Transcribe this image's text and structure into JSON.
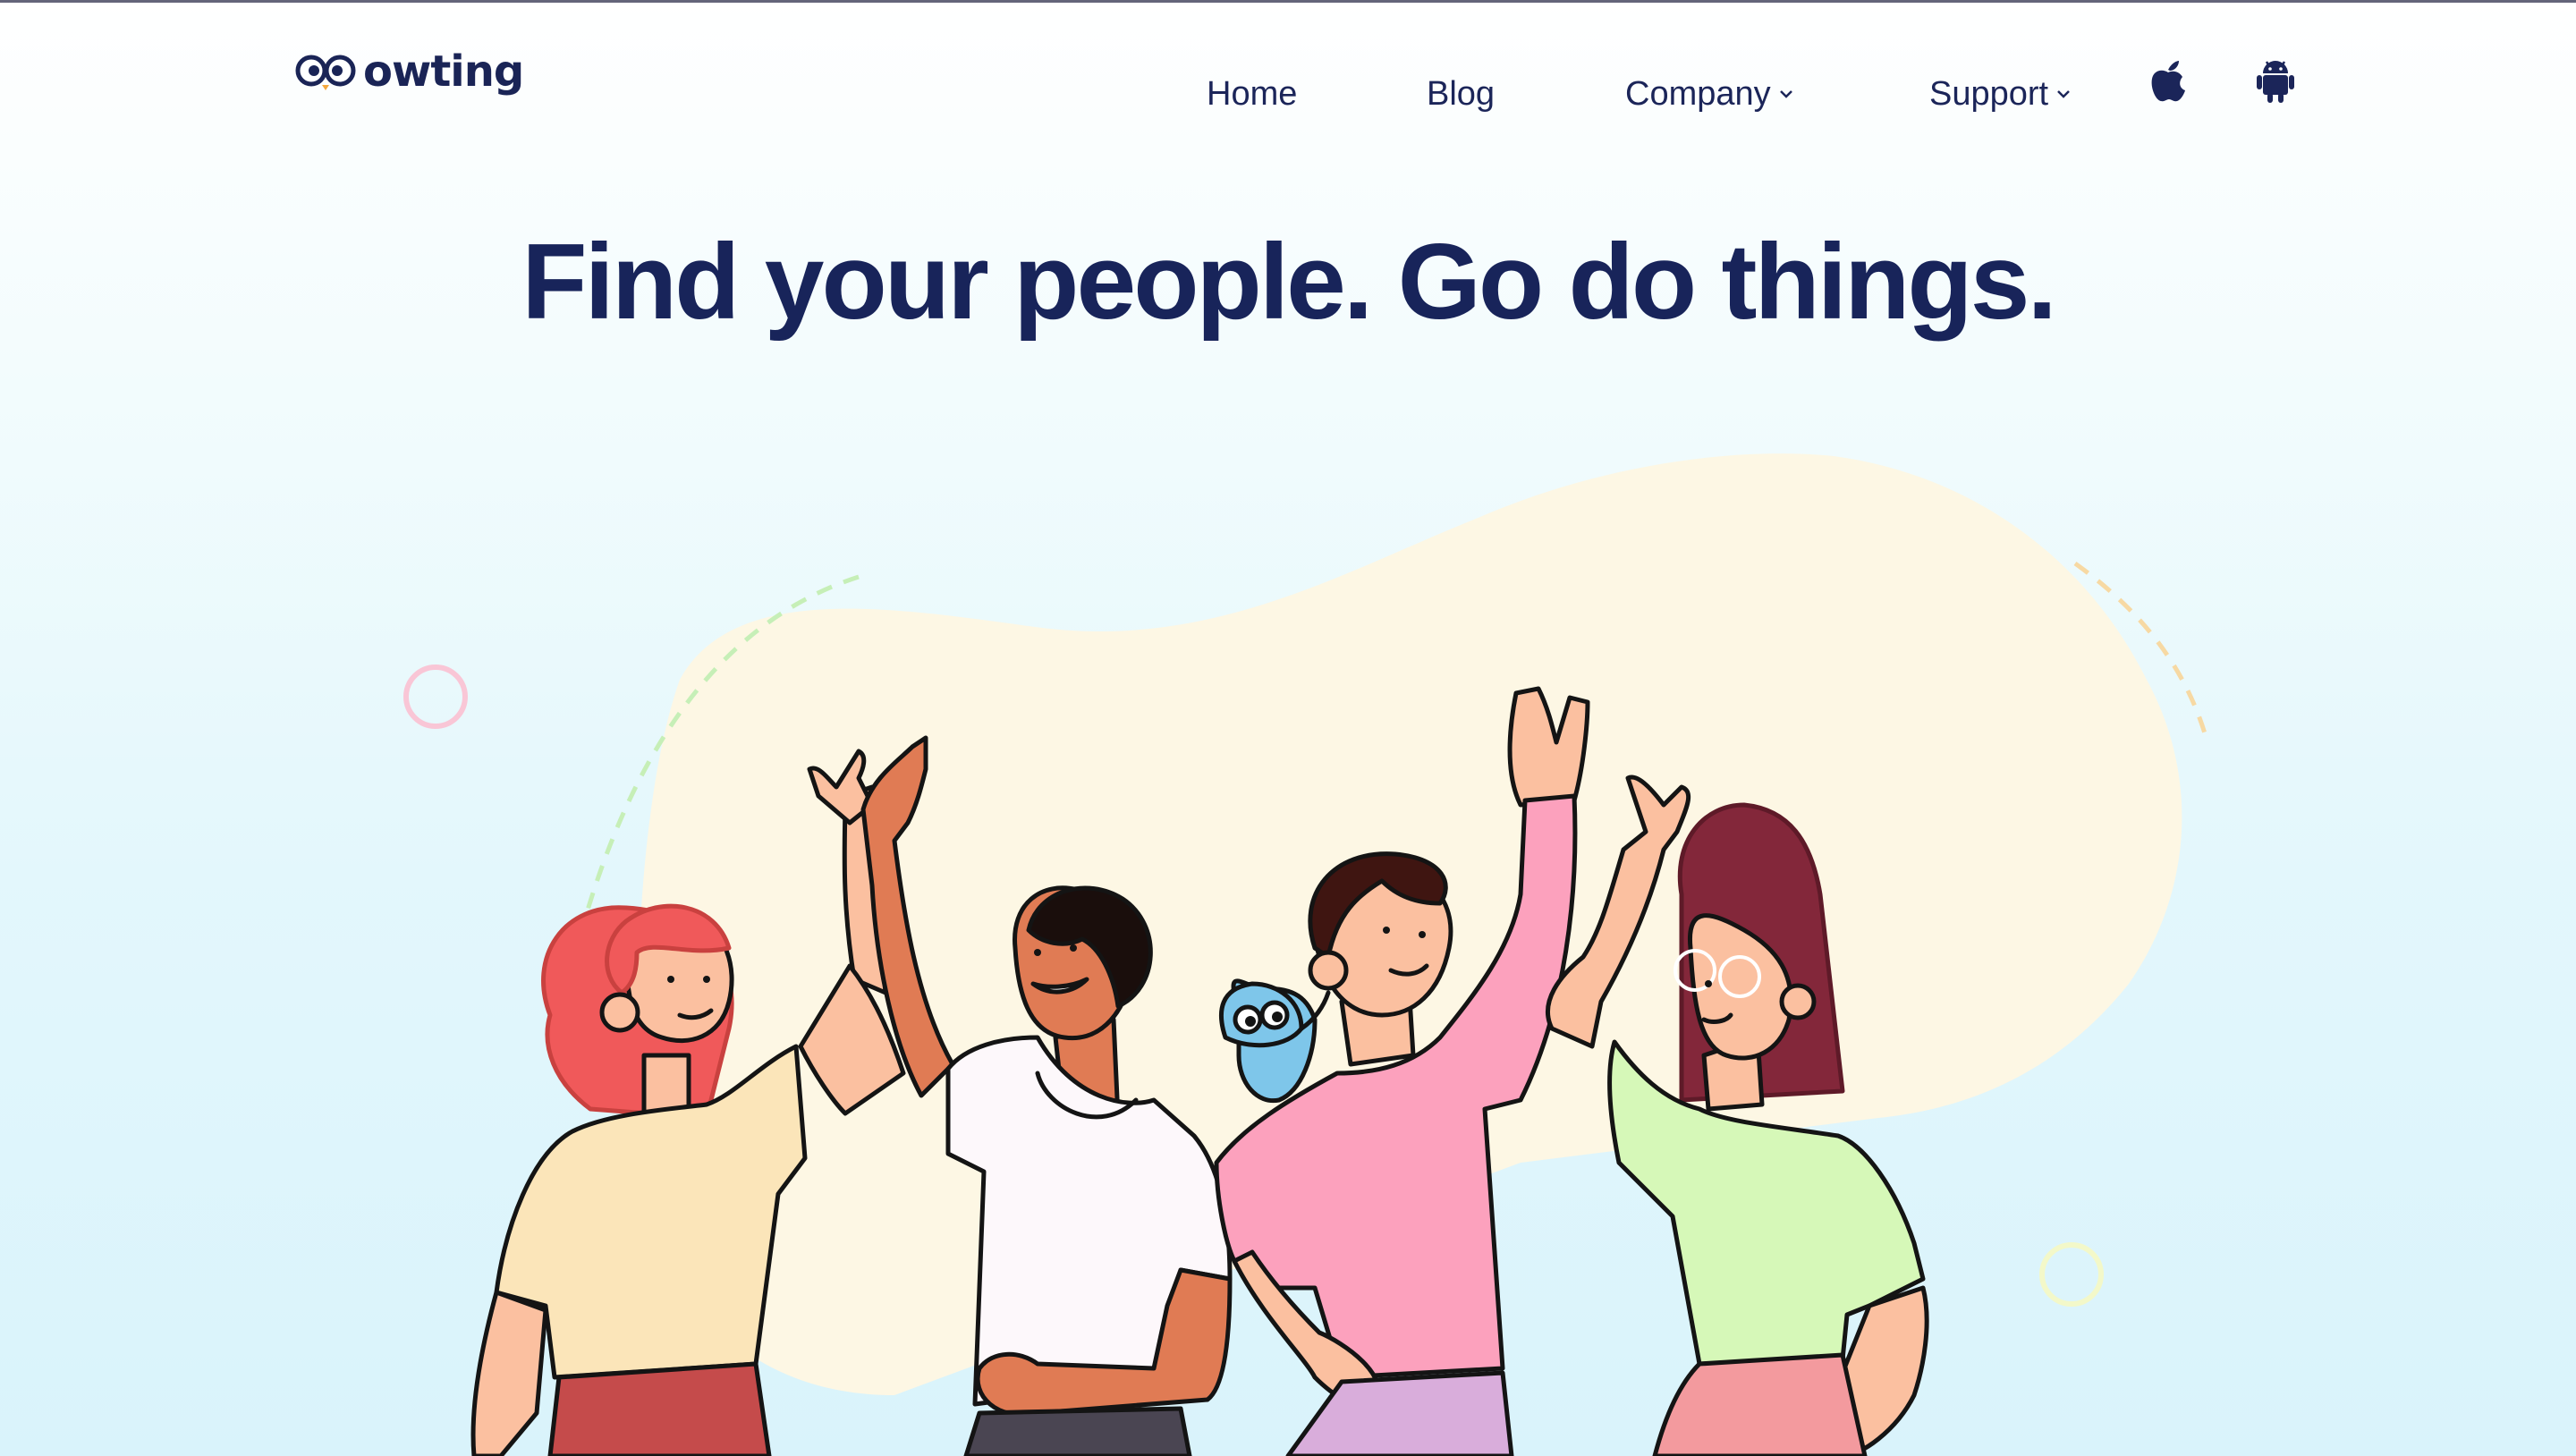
{
  "brand": {
    "name": "owting",
    "icon": "owl-eyes-icon",
    "color": "#1a2456"
  },
  "nav": {
    "items": [
      {
        "label": "Home",
        "has_dropdown": false
      },
      {
        "label": "Blog",
        "has_dropdown": false
      },
      {
        "label": "Company",
        "has_dropdown": true
      },
      {
        "label": "Support",
        "has_dropdown": true
      }
    ],
    "app_store_icons": [
      "apple-icon",
      "android-icon"
    ]
  },
  "hero": {
    "title": "Find your people. Go do things."
  },
  "colors": {
    "text": "#18245a",
    "blob": "#fdf7e4",
    "shirt_yellow": "#fbe5b9",
    "shirt_white": "#fdf8fb",
    "shirt_pink": "#fca1bd",
    "shirt_green": "#d6f8b8",
    "owl_blue": "#7ec6ea"
  }
}
